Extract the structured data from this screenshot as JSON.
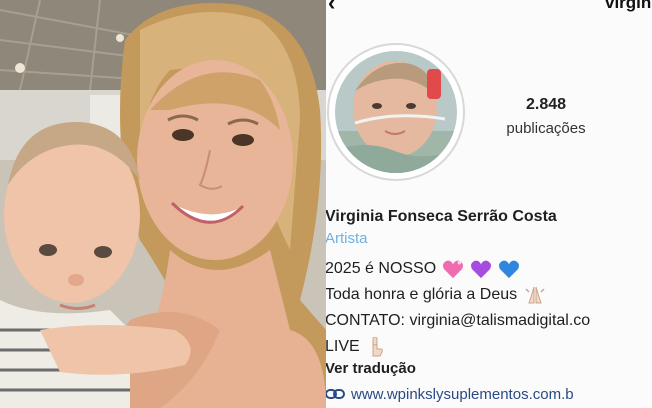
{
  "profile": {
    "username": "virgini",
    "stats": {
      "count": "2.848",
      "label": "publicações"
    },
    "name": "Virginia Fonseca Serrão Costa",
    "category": "Artista",
    "bio_lines": [
      "2025 é NOSSO",
      "Toda honra e glória a Deus",
      "CONTATO: virginia@talismadigital.co",
      "LIVE"
    ],
    "translate": "Ver tradução",
    "link": "www.wpinkslysuplementos.com.b"
  },
  "icons": {
    "back": "arrow-left-icon",
    "hearts": [
      "pink-sparkle-heart-icon",
      "purple-heart-icon",
      "blue-heart-icon"
    ],
    "pray": "praying-hands-icon",
    "point_down": "pointing-down-icon",
    "link": "link-icon"
  },
  "colors": {
    "category": "#6fb1e3",
    "link": "#2a4a86",
    "heart_pink": "#f06bb0",
    "heart_purple": "#a64de0",
    "heart_blue": "#2e86de"
  }
}
